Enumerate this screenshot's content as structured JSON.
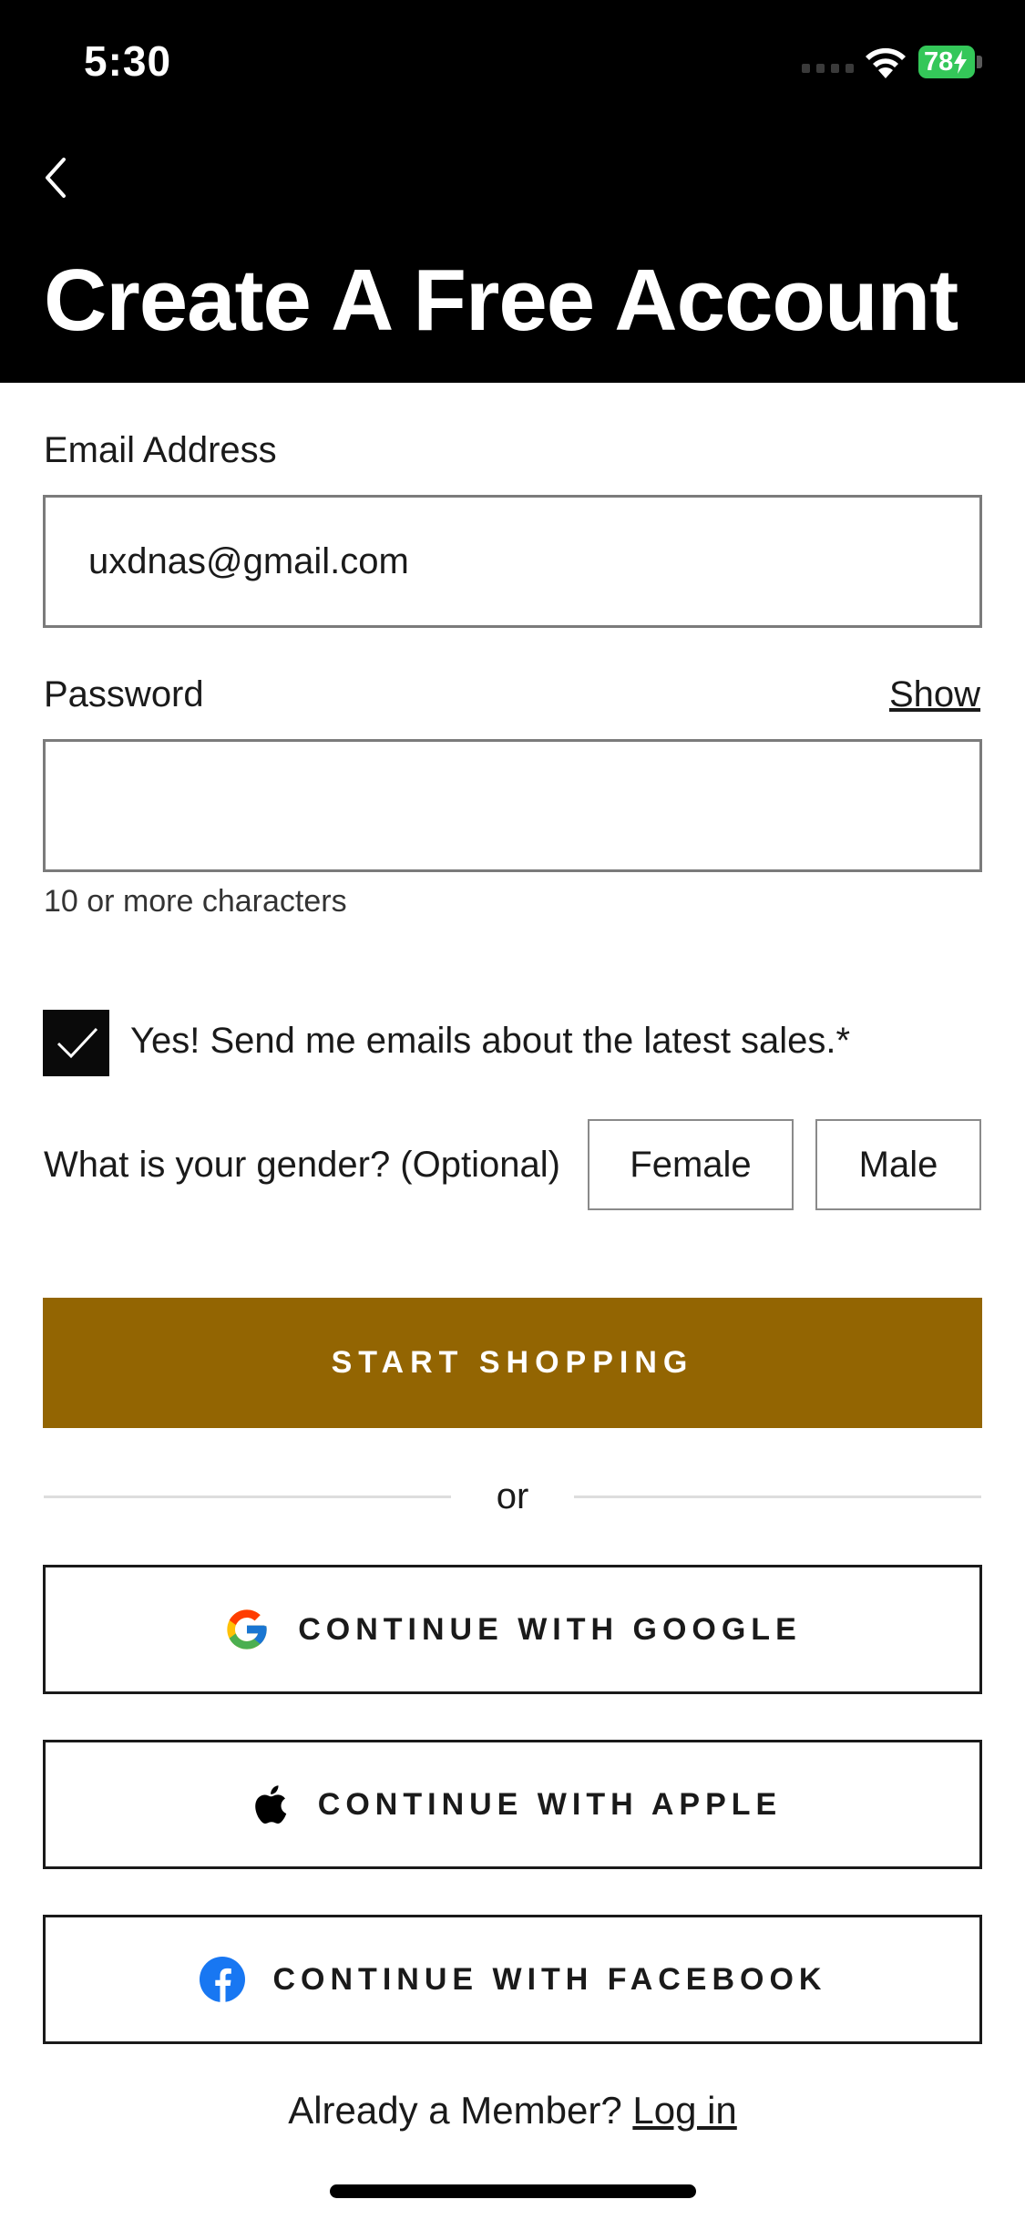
{
  "status_bar": {
    "time": "5:30",
    "battery": "78"
  },
  "header": {
    "title": "Create A Free Account"
  },
  "email": {
    "label": "Email Address",
    "value": "uxdnas@gmail.com"
  },
  "password": {
    "label": "Password",
    "show_label": "Show",
    "value": "",
    "hint": "10 or more characters"
  },
  "newsletter": {
    "label": "Yes! Send me emails about the latest sales.*",
    "checked": true
  },
  "gender": {
    "question": "What is your gender? (Optional)",
    "options": [
      "Female",
      "Male"
    ]
  },
  "primary_button": {
    "label": "START SHOPPING"
  },
  "colors": {
    "accent": "#936502",
    "header_bg": "#000000",
    "battery_green": "#34c759"
  },
  "divider": {
    "label": "or"
  },
  "social_buttons": [
    {
      "label": "CONTINUE WITH GOOGLE",
      "icon": "google-icon"
    },
    {
      "label": "CONTINUE WITH APPLE",
      "icon": "apple-icon"
    },
    {
      "label": "CONTINUE WITH FACEBOOK",
      "icon": "facebook-icon"
    }
  ],
  "footer": {
    "prompt": "Already a Member?",
    "login_label": "Log in"
  }
}
